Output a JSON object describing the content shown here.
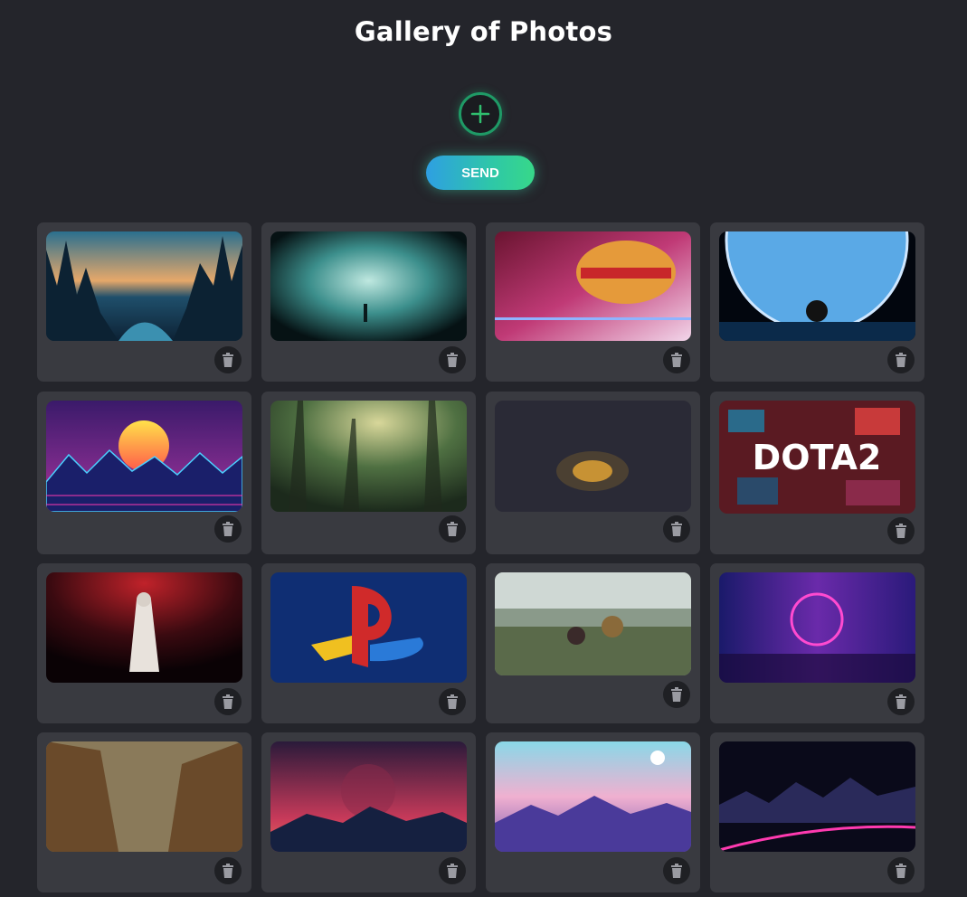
{
  "header": {
    "title": "Gallery of Photos"
  },
  "actions": {
    "add_icon": "plus-circle-icon",
    "send_label": "SEND"
  },
  "colors": {
    "background": "#24252b",
    "card": "#393a40",
    "accent_green": "#1f9a66",
    "send_gradient": [
      "#2e9fe2",
      "#37d889"
    ]
  },
  "gallery": {
    "photos": [
      {
        "name": "forest-lake-sunset",
        "delete_icon": "trash-icon"
      },
      {
        "name": "mystic-cave-portal",
        "delete_icon": "trash-icon"
      },
      {
        "name": "straw-hat-anime",
        "delete_icon": "trash-icon"
      },
      {
        "name": "earth-from-space",
        "delete_icon": "trash-icon"
      },
      {
        "name": "synthwave-sun",
        "delete_icon": "trash-icon"
      },
      {
        "name": "misty-forest",
        "delete_icon": "trash-icon"
      },
      {
        "name": "dark-cave-lantern",
        "delete_icon": "trash-icon"
      },
      {
        "name": "dota-2-stickers",
        "delete_icon": "trash-icon",
        "caption": "DOTA2"
      },
      {
        "name": "assassin-red",
        "delete_icon": "trash-icon"
      },
      {
        "name": "playstation-logo",
        "delete_icon": "trash-icon"
      },
      {
        "name": "anime-adventure",
        "delete_icon": "trash-icon"
      },
      {
        "name": "neon-ring",
        "delete_icon": "trash-icon"
      },
      {
        "name": "giant-hands-rain",
        "delete_icon": "trash-icon"
      },
      {
        "name": "crimson-mountains",
        "delete_icon": "trash-icon"
      },
      {
        "name": "pastel-planet-landscape",
        "delete_icon": "trash-icon"
      },
      {
        "name": "neon-mountain-night",
        "delete_icon": "trash-icon"
      }
    ]
  }
}
